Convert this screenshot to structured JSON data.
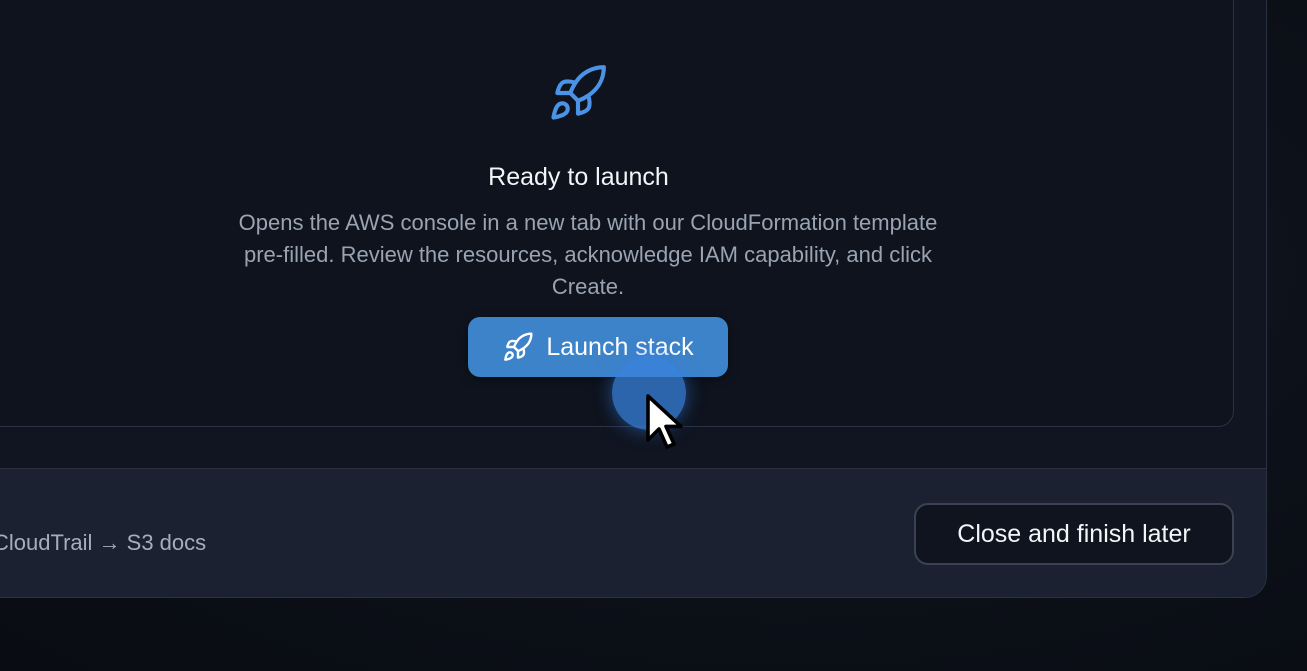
{
  "launch_card": {
    "icon": "rocket-icon",
    "title": "Ready to launch",
    "description": "Opens the AWS console in a new tab with our CloudFormation template pre-filled. Review the resources, acknowledge IAM capability, and click Create.",
    "button_label": "Launch stack",
    "button_icon": "rocket-icon"
  },
  "footer": {
    "link_text": "CloudTrail → S3 docs",
    "close_label": "Close and finish later"
  },
  "colors": {
    "accent": "#3d83c9",
    "icon_blue": "#4b93e6",
    "background": "#0e131d"
  }
}
